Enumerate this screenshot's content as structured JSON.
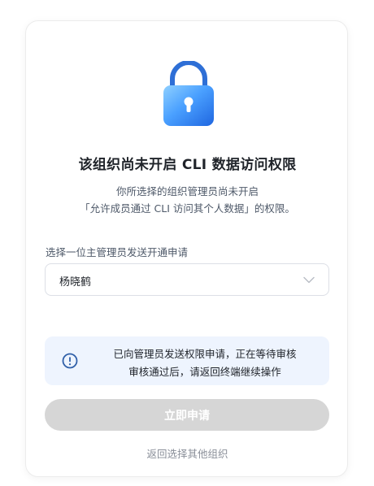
{
  "dialog": {
    "title": "该组织尚未开启 CLI 数据访问权限",
    "description_line1": "你所选择的组织管理员尚未开启",
    "description_line2": "「允许成员通过 CLI 访问其个人数据」的权限。",
    "select_label": "选择一位主管理员发送开通申请",
    "selected_admin": "杨晓鹤",
    "notice_line1": "已向管理员发送权限申请，正在等待审核",
    "notice_line2": "审核通过后，请返回终端继续操作",
    "apply_button_label": "立即申请",
    "back_link_label": "返回选择其他组织"
  },
  "icons": {
    "lock": "lock-icon",
    "chevron": "chevron-down-icon",
    "info": "info-icon"
  },
  "colors": {
    "lock_gradient_start": "#5fb2ff",
    "lock_gradient_end": "#1f6fe8",
    "shackle": "#2e6fd6",
    "notice_background": "#eef4fe",
    "info_icon": "#2f5fa8",
    "disabled_button": "#d6d6d6"
  }
}
